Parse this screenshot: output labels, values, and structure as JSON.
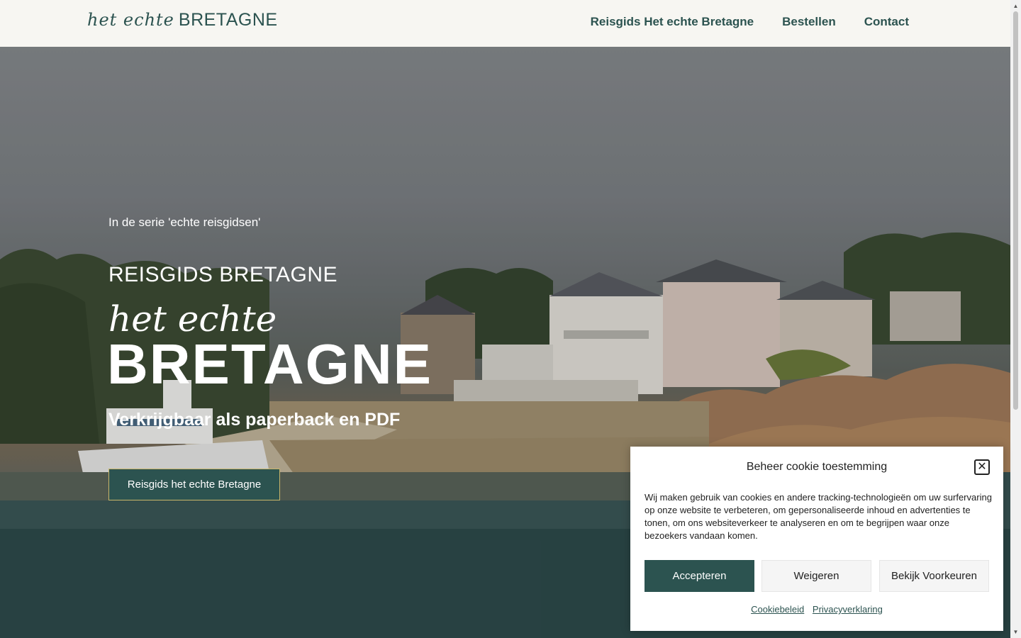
{
  "header": {
    "logo_script": "het echte",
    "logo_caps": "BRETAGNE",
    "nav": [
      "Reisgids Het echte Bretagne",
      "Bestellen",
      "Contact"
    ]
  },
  "hero": {
    "kicker": "In de serie 'echte reisgidsen'",
    "subtitle": "REISGIDS BRETAGNE",
    "script": "het echte",
    "title": "BRETAGNE",
    "tagline": "Verkrijgbaar als paperback en PDF",
    "button_label": "Reisgids het echte Bretagne"
  },
  "cookie": {
    "title": "Beheer cookie toestemming",
    "text": "Wij maken gebruik van cookies en andere tracking-technologieën om uw surfervaring op onze website te verbeteren, om gepersonaliseerde inhoud en advertenties te tonen, om ons websiteverkeer te analyseren en om te begrijpen waar onze bezoekers vandaan komen.",
    "accept": "Accepteren",
    "deny": "Weigeren",
    "preferences": "Bekijk Voorkeuren",
    "links": [
      "Cookiebeleid",
      "Privacyverklaring"
    ]
  },
  "colors": {
    "brand": "#2c5350",
    "button_border": "#c9b66a",
    "header_bg": "#f7f6f2"
  }
}
